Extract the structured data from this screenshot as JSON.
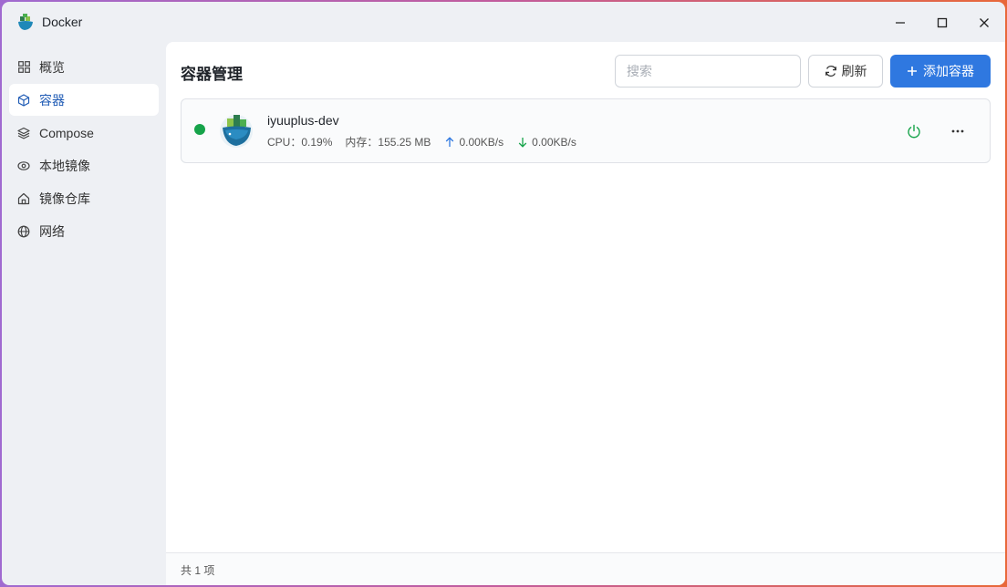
{
  "window": {
    "title": "Docker",
    "controls": [
      "minimize-icon",
      "maximize-icon",
      "close-icon"
    ]
  },
  "sidebar": {
    "items": [
      {
        "label": "概览",
        "icon": "grid-icon",
        "active": false
      },
      {
        "label": "容器",
        "icon": "cube-icon",
        "active": true
      },
      {
        "label": "Compose",
        "icon": "layers-icon",
        "active": false
      },
      {
        "label": "本地镜像",
        "icon": "eye-icon",
        "active": false
      },
      {
        "label": "镜像仓库",
        "icon": "home-icon",
        "active": false
      },
      {
        "label": "网络",
        "icon": "globe-icon",
        "active": false
      }
    ]
  },
  "main": {
    "title": "容器管理",
    "search": {
      "placeholder": "搜索",
      "value": ""
    },
    "refresh_label": "刷新",
    "add_label": "添加容器"
  },
  "containers": [
    {
      "name": "iyuuplus-dev",
      "status": "running",
      "cpu_label": "CPU：",
      "cpu": "0.19%",
      "mem_label": "内存：",
      "mem": "155.25 MB",
      "upload": "0.00KB/s",
      "download": "0.00KB/s"
    }
  ],
  "footer": {
    "total": "共 1 项"
  },
  "colors": {
    "accent": "#2f78e0",
    "running": "#16a34a",
    "active_nav_text": "#1f5bb5"
  }
}
